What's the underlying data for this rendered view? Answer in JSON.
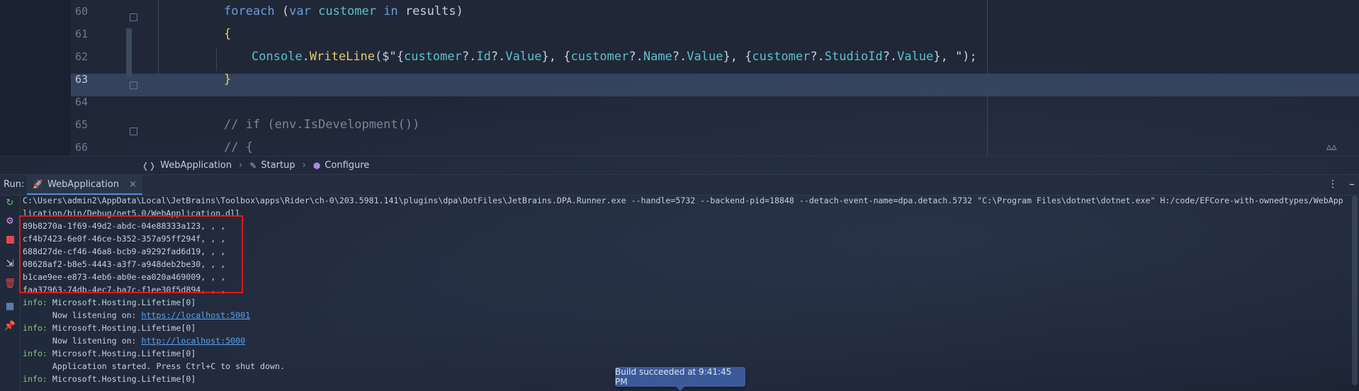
{
  "editor": {
    "lines": [
      {
        "num": "60",
        "parts": [
          [
            "kw",
            "foreach "
          ],
          [
            "var",
            "("
          ],
          [
            "kw",
            "var "
          ],
          [
            "cls",
            "customer "
          ],
          [
            "kw",
            "in "
          ],
          [
            "var",
            "results)"
          ]
        ]
      },
      {
        "num": "61",
        "parts": [
          [
            "brace",
            "{"
          ]
        ]
      },
      {
        "num": "62",
        "parts": [
          [
            "cls",
            "Console"
          ],
          [
            "var",
            "."
          ],
          [
            "fn",
            "WriteLine"
          ],
          [
            "var",
            "($\"{"
          ],
          [
            "cls",
            "customer"
          ],
          [
            "var",
            "?."
          ],
          [
            "cls",
            "Id"
          ],
          [
            "var",
            "?."
          ],
          [
            "cls",
            "Value"
          ],
          [
            "var",
            "}, {"
          ],
          [
            "cls",
            "customer"
          ],
          [
            "var",
            "?."
          ],
          [
            "cls",
            "Name"
          ],
          [
            "var",
            "?."
          ],
          [
            "cls",
            "Value"
          ],
          [
            "var",
            "}, {"
          ],
          [
            "cls",
            "customer"
          ],
          [
            "var",
            "?."
          ],
          [
            "cls",
            "StudioId"
          ],
          [
            "var",
            "?."
          ],
          [
            "cls",
            "Value"
          ],
          [
            "var",
            "}, \");"
          ]
        ]
      },
      {
        "num": "63",
        "parts": [
          [
            "brace",
            "}"
          ]
        ]
      },
      {
        "num": "64",
        "parts": []
      },
      {
        "num": "65",
        "parts": [
          [
            "comment",
            "// if (env.IsDevelopment())"
          ]
        ]
      },
      {
        "num": "66",
        "parts": [
          [
            "comment",
            "// {"
          ]
        ]
      }
    ]
  },
  "breadcrumb": {
    "items": [
      "WebApplication",
      "Startup",
      "Configure"
    ]
  },
  "run": {
    "label": "Run:",
    "tab_label": "WebApplication",
    "close_glyph": "×",
    "kebab_glyph": "⋮",
    "minimize_glyph": "–"
  },
  "console": {
    "command_line_1": "C:\\Users\\admin2\\AppData\\Local\\JetBrains\\Toolbox\\apps\\Rider\\ch-0\\203.5981.141\\plugins\\dpa\\DotFiles\\JetBrains.DPA.Runner.exe --handle=5732 --backend-pid=18848 --detach-event-name=dpa.detach.5732 \"C:\\Program Files\\dotnet\\dotnet.exe\" H:/code/EFCore-with-ownedtypes/WebApp",
    "command_line_2": "lication/bin/Debug/net5.0/WebApplication.dll",
    "results": [
      "89b8270a-1f69-49d2-abdc-04e88333a123, , ,",
      "cf4b7423-6e0f-46ce-b352-357a95ff294f, , ,",
      "688d27de-cf46-46a8-bcb9-a9292fad6d19, , ,",
      "08628af2-b8e5-4443-a3f7-a948deb2be30, , ,",
      "b1cae9ee-e873-4eb6-ab0e-ea020a469009, , ,",
      "faa37963-74db-4ec7-ba7c-f1ee30f5d894, , ,"
    ],
    "info_prefix": "info:",
    "log": [
      {
        "type": "info",
        "text": " Microsoft.Hosting.Lifetime[0]"
      },
      {
        "type": "detail",
        "text": "      Now listening on: ",
        "link": "https://localhost:5001"
      },
      {
        "type": "info",
        "text": " Microsoft.Hosting.Lifetime[0]"
      },
      {
        "type": "detail",
        "text": "      Now listening on: ",
        "link": "http://localhost:5000"
      },
      {
        "type": "info",
        "text": " Microsoft.Hosting.Lifetime[0]"
      },
      {
        "type": "detail",
        "text": "      Application started. Press Ctrl+C to shut down."
      },
      {
        "type": "info",
        "text": " Microsoft.Hosting.Lifetime[0]"
      }
    ]
  },
  "toast": {
    "text": "Build succeeded at 9:41:45 PM"
  },
  "colors": {
    "accent": "#4f8ad9",
    "highlight_box": "#e01818",
    "info_green": "#8ac27a",
    "link_blue": "#5aa2f2"
  },
  "icons": [
    "rerun-icon",
    "settings-icon",
    "stop-icon",
    "restore-layout-icon",
    "delete-icon",
    "grid-icon",
    "pin-icon",
    "run-icon",
    "namespace-icon",
    "class-icon",
    "method-icon"
  ]
}
